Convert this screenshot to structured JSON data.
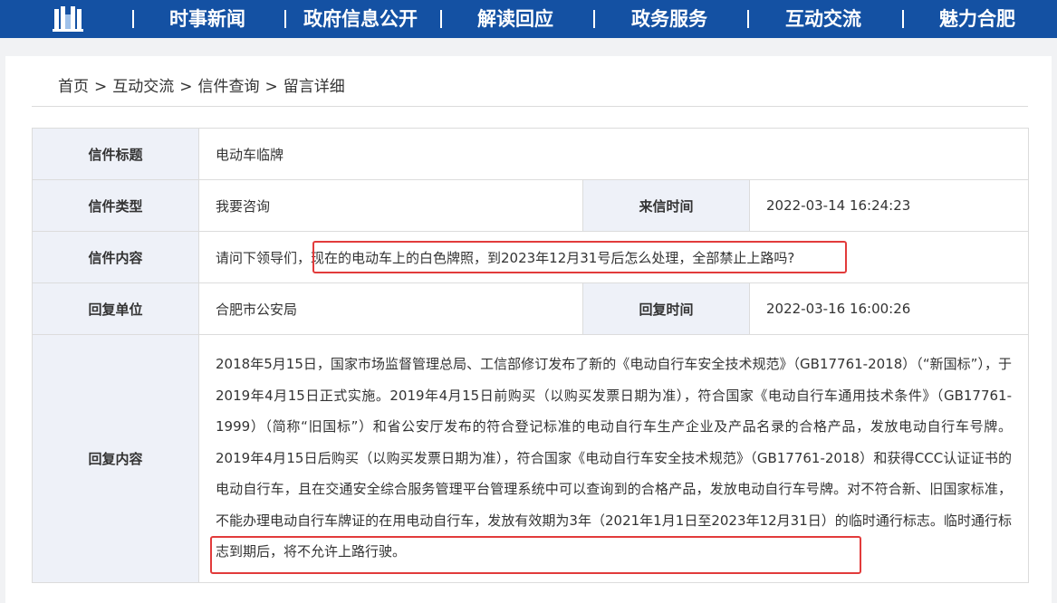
{
  "nav": {
    "items": [
      {
        "label": "时事新闻"
      },
      {
        "label": "政府信息公开"
      },
      {
        "label": "解读回应"
      },
      {
        "label": "政务服务"
      },
      {
        "label": "互动交流"
      },
      {
        "label": "魅力合肥"
      }
    ]
  },
  "breadcrumb": {
    "items": [
      "首页",
      "互动交流",
      "信件查询",
      "留言详细"
    ],
    "separator": ">"
  },
  "letter": {
    "title_label": "信件标题",
    "title": "电动车临牌",
    "type_label": "信件类型",
    "type": "我要咨询",
    "sent_time_label": "来信时间",
    "sent_time": "2022-03-14 16:24:23",
    "content_label": "信件内容",
    "content": "请问下领导们，现在的电动车上的白色牌照，到2023年12月31号后怎么处理，全部禁止上路吗?",
    "reply_unit_label": "回复单位",
    "reply_unit": "合肥市公安局",
    "reply_time_label": "回复时间",
    "reply_time": "2022-03-16 16:00:26",
    "reply_content_label": "回复内容",
    "reply_content": "2018年5月15日，国家市场监督管理总局、工信部修订发布了新的《电动自行车安全技术规范》（GB17761-2018）（“新国标”），于2019年4月15日正式实施。2019年4月15日前购买（以购买发票日期为准），符合国家《电动自行车通用技术条件》（GB17761-1999）（简称“旧国标”）和省公安厅发布的符合登记标准的电动自行车生产企业及产品名录的合格产品，发放电动自行车号牌。2019年4月15日后购买（以购买发票日期为准），符合国家《电动自行车安全技术规范》（GB17761-2018）和获得CCC认证证书的电动自行车，且在交通安全综合服务管理平台管理系统中可以查询到的合格产品，发放电动自行车号牌。对不符合新、旧国家标准，不能办理电动自行车牌证的在用电动自行车，发放有效期为3年（2021年1月1日至2023年12月31日）的临时通行标志。临时通行标志到期后，将不允许上路行驶。"
  },
  "colors": {
    "nav_bg": "#1451a3",
    "label_bg": "#eef1f8",
    "label_text": "#1e3d7a",
    "highlight": "#e23b3b"
  },
  "icons": {
    "logo": "city-building-logo-icon"
  }
}
